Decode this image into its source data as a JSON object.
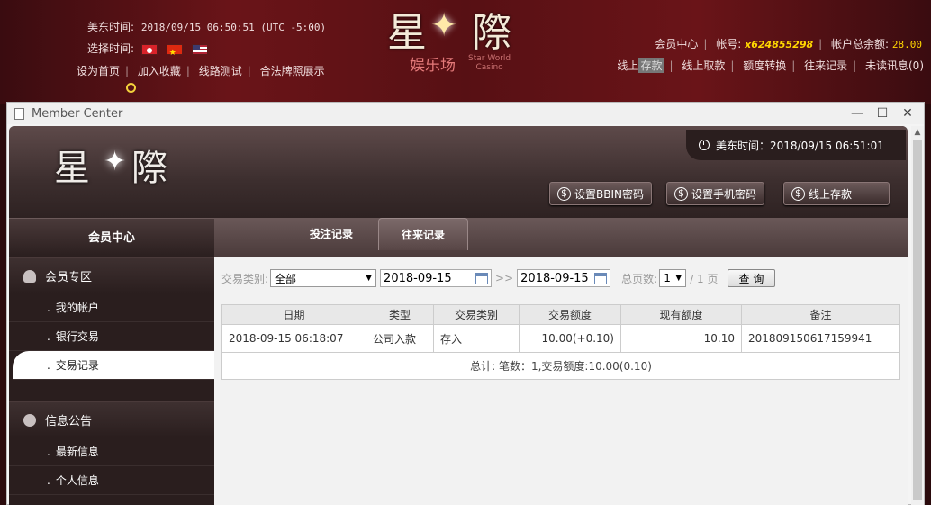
{
  "header": {
    "et_label": "美东时间:",
    "et_value": "2018/09/15 06:50:51 (UTC -5:00)",
    "lang_label": "选择时间:",
    "links": [
      "设为首页",
      "加入收藏",
      "线路测试",
      "合法牌照展示"
    ],
    "logo_text": "星",
    "logo_text2": "際",
    "logo_cn": "娱乐场",
    "logo_en1": "Star World",
    "logo_en2": "Casino",
    "member_center": "会员中心",
    "account_label": "帐号:",
    "account_value": "x624855298",
    "balance_label": "帐户总余额:",
    "balance_value": "28.00",
    "nav_pre": "线上",
    "nav_tip": "存款",
    "nav": [
      "线上取款",
      "额度转换",
      "往来记录",
      "未读讯息(0)"
    ]
  },
  "window": {
    "title": "Member Center"
  },
  "top": {
    "clock_label": "美东时间：2018/09/15 06:51:01",
    "btn_bbin": "设置BBIN密码",
    "btn_phone": "设置手机密码",
    "btn_deposit": "线上存款"
  },
  "sidebar": {
    "header": "会员中心",
    "section1": "会员专区",
    "items1": [
      "我的帐户",
      "银行交易",
      "交易记录"
    ],
    "section2": "信息公告",
    "items2": [
      "最新信息",
      "个人信息"
    ]
  },
  "tabs": {
    "bets": "投注记录",
    "history": "往来记录"
  },
  "filter": {
    "type_label": "交易类别:",
    "type_value": "全部",
    "date_from": "2018-09-15",
    "sep": ">>",
    "date_to": "2018-09-15",
    "pages_label": "总页数:",
    "page_value": "1",
    "pages_total": "/ 1 页",
    "query": "查 询"
  },
  "table": {
    "headers": [
      "日期",
      "类型",
      "交易类别",
      "交易额度",
      "现有额度",
      "备注"
    ],
    "rows": [
      [
        "2018-09-15 06:18:07",
        "公司入款",
        "存入",
        "10.00(+0.10)",
        "10.10",
        "201809150617159941"
      ]
    ],
    "total": "总计: 笔数：1,交易额度:10.00(0.10)"
  },
  "colors": {
    "accent_yellow": "#ffd700",
    "header_red": "#6a1418",
    "panel_dark": "#2a1e1e"
  }
}
